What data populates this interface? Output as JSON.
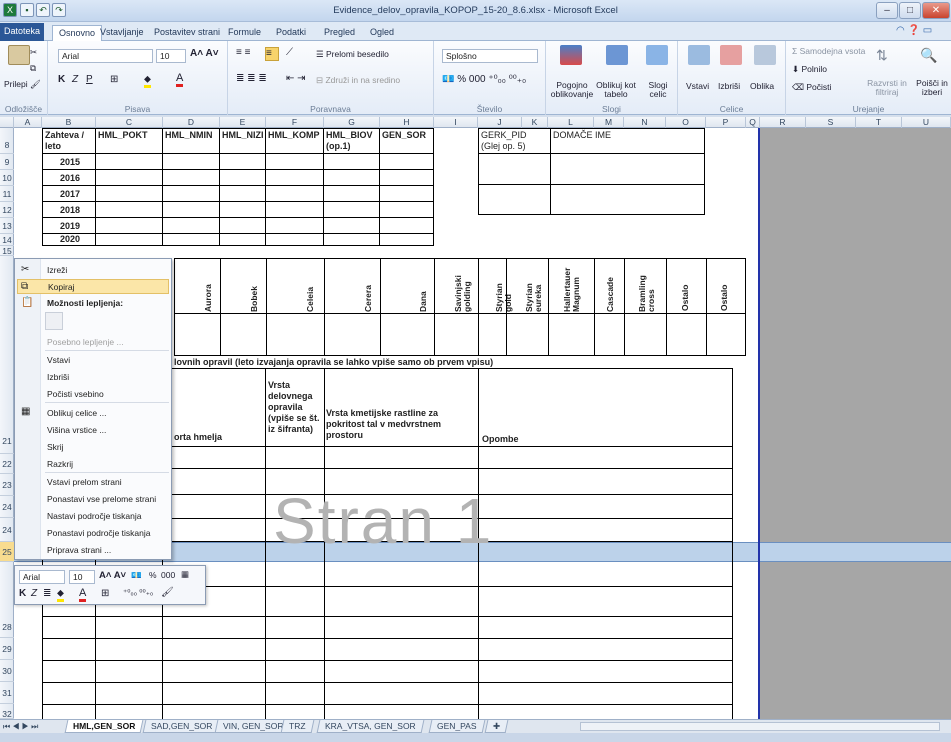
{
  "window": {
    "title": "Evidence_delov_opravila_KOPOP_15-20_8.6.xlsx - Microsoft Excel"
  },
  "tabs": [
    "Datoteka",
    "Osnovno",
    "Vstavljanje",
    "Postavitev strani",
    "Formule",
    "Podatki",
    "Pregled",
    "Ogled"
  ],
  "ribbon": {
    "clipboard": {
      "paste": "Prilepi",
      "label": "Odložišče"
    },
    "font": {
      "name": "Arial",
      "size": "10",
      "label": "Pisava"
    },
    "alignment": {
      "wrap": "Prelomi besedilo",
      "merge": "Združi in na sredino",
      "label": "Poravnava"
    },
    "number": {
      "format": "Splošno",
      "label": "Število"
    },
    "styles": {
      "cond": "Pogojno oblikovanje",
      "table": "Oblikuj kot tabelo",
      "cell": "Slogi celic",
      "label": "Slogi"
    },
    "cells": {
      "insert": "Vstavi",
      "delete": "Izbriši",
      "format": "Oblika",
      "label": "Celice"
    },
    "editing": {
      "autosum": "Samodejna vsota",
      "fill": "Polnilo",
      "clear": "Počisti",
      "sort": "Razvrsti in filtriraj",
      "find": "Poišči in izberi",
      "label": "Urejanje"
    }
  },
  "columns": [
    "A",
    "B",
    "C",
    "D",
    "E",
    "F",
    "G",
    "H",
    "I",
    "J",
    "K",
    "L",
    "M",
    "N",
    "O",
    "P",
    "Q",
    "R",
    "S",
    "T",
    "U"
  ],
  "rows": [
    "8",
    "9",
    "10",
    "11",
    "12",
    "13",
    "14",
    "15",
    "16",
    "17",
    "18",
    "19",
    "20",
    "21",
    "22",
    "23",
    "24",
    "25",
    "26",
    "27",
    "28",
    "29",
    "30",
    "31",
    "32"
  ],
  "table1": {
    "headers": [
      "Zahteva / leto",
      "HML_POKT",
      "HML_NMIN",
      "HML_NIZI",
      "HML_KOMP",
      "HML_BIOV (op.1)",
      "GEN_SOR"
    ],
    "years": [
      "2015",
      "2016",
      "2017",
      "2018",
      "2019",
      "2020"
    ],
    "gerk": "GERK_PID (Glej op. 5)",
    "domace": "DOMAČE IME"
  },
  "varieties": [
    "Aurora",
    "Bobek",
    "Celeia",
    "Cerera",
    "Dana",
    "Savinjski golding",
    "Styrian gold",
    "Styrian eureka",
    "Hallertauer Magnum",
    "Cascade",
    "Bramling cross",
    "Ostalo",
    "Ostalo"
  ],
  "section2": {
    "title": "lovnih opravil (leto izvajanja opravila se lahko vpiše samo ob prvem vpisu)",
    "col_sorta": "orta hmelja",
    "col_vrsta": "Vrsta delovnega opravila (vpiše se št. iz šifranta)",
    "col_kmet": "Vrsta kmetijske rastline za pokritost tal v medvrstnem prostoru",
    "col_opombe": "Opombe"
  },
  "watermark": "Stran 1",
  "context_menu": {
    "items": [
      "Izreži",
      "Kopiraj",
      "Možnosti lepljenja:",
      "Posebno lepljenje ...",
      "Vstavi",
      "Izbriši",
      "Počisti vsebino",
      "Oblikuj celice ...",
      "Višina vrstice ...",
      "Skrij",
      "Razkrij",
      "Vstavi prelom strani",
      "Ponastavi vse prelome strani",
      "Nastavi področje tiskanja",
      "Ponastavi področje tiskanja",
      "Priprava strani ..."
    ]
  },
  "mini_toolbar": {
    "font": "Arial",
    "size": "10",
    "percent": "%",
    "thousands": "000"
  },
  "sheet_tabs": [
    "HML,GEN_SOR",
    "SAD,GEN_SOR",
    "VIN, GEN_SOR",
    "TRZ",
    "KRA_VTSA, GEN_SOR",
    "GEN_PAS"
  ],
  "colors": {
    "accent": "#2b5797",
    "highlight": "#fbe6a8",
    "selected_row": "#bcd2ea",
    "page_break": "#2233aa"
  }
}
